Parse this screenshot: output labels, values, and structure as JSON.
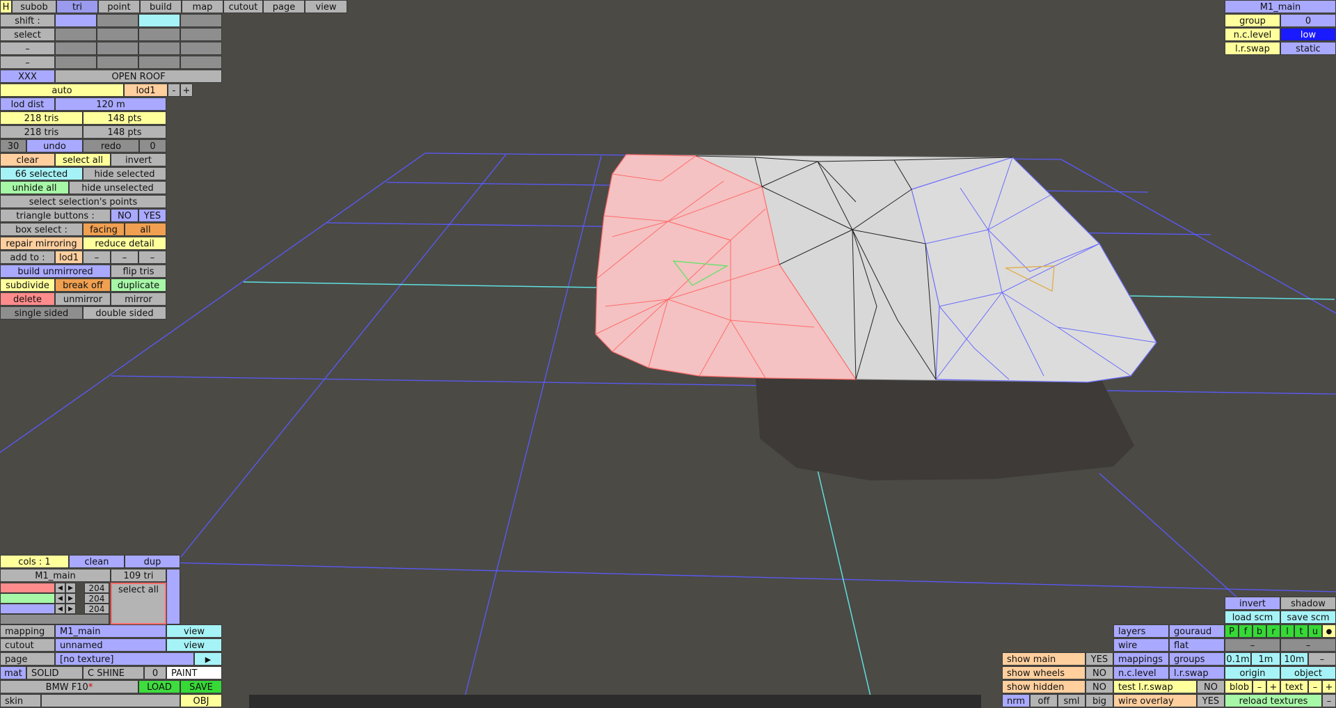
{
  "top_tabs": [
    "H",
    "subob",
    "tri",
    "point",
    "build",
    "map",
    "cutout",
    "page",
    "view"
  ],
  "shift_label": "shift :",
  "select_label": "select",
  "dash": "–",
  "xxx": "XXX",
  "open_roof": "OPEN ROOF",
  "auto": "auto",
  "lod1": "lod1",
  "minus": "-",
  "plus": "+",
  "lod_dist_label": "lod dist",
  "lod_dist_value": "120 m",
  "tris1": "218 tris",
  "pts1": "148 pts",
  "tris2": "218 tris",
  "pts2": "148 pts",
  "undo_count": "30",
  "undo": "undo",
  "redo": "redo",
  "redo_count": "0",
  "clear": "clear",
  "select_all": "select all",
  "invert": "invert",
  "selected_count": "66 selected",
  "hide_selected": "hide selected",
  "unhide_all": "unhide all",
  "hide_unselected": "hide unselected",
  "select_selection_points": "select selection's points",
  "triangle_buttons": "triangle buttons :",
  "no": "NO",
  "yes": "YES",
  "box_select": "box select :",
  "facing": "facing",
  "all": "all",
  "repair_mirroring": "repair mirroring",
  "reduce_detail": "reduce detail",
  "add_to": "add to :",
  "add_lod": "lod1",
  "build_unmirrored": "build unmirrored",
  "flip_tris": "flip tris",
  "subdivide": "subdivide",
  "break_off": "break off",
  "duplicate": "duplicate",
  "delete": "delete",
  "unmirror": "unmirror",
  "mirror": "mirror",
  "single_sided": "single sided",
  "double_sided": "double sided",
  "top_right": {
    "title": "M1_main",
    "group_label": "group",
    "group_value": "0",
    "nc_level_label": "n.c.level",
    "nc_level_value": "low",
    "lr_swap_label": "l.r.swap",
    "lr_swap_value": "static"
  },
  "bottom_left": {
    "cols": "cols : 1",
    "clean": "clean",
    "dup": "dup",
    "mat_name": "M1_main",
    "tri_count": "109 tri",
    "rgb": [
      "204",
      "204",
      "204"
    ],
    "select_all": "select all",
    "mapping_label": "mapping",
    "mapping_value": "M1_main",
    "view": "view",
    "cutout_label": "cutout",
    "cutout_value": "unnamed",
    "page_label": "page",
    "page_value": "[no texture]",
    "page_arrow": "▶",
    "mat": "mat",
    "solid": "SOLID",
    "c_shine": "C SHINE",
    "zero": "0",
    "paint": "PAINT",
    "car_name": "BMW F10",
    "asterisk": "*",
    "load": "LOAD",
    "save": "SAVE",
    "skin": "skin",
    "obj": "OBJ"
  },
  "bottom_right": {
    "invert": "invert",
    "shadow": "shadow",
    "load_scm": "load scm",
    "save_scm": "save scm",
    "layers": "layers",
    "gouraud": "gouraud",
    "letters": [
      "P",
      "f",
      "b",
      "r",
      "l",
      "t",
      "u"
    ],
    "dot": "●",
    "wire": "wire",
    "flat": "flat",
    "show_main": "show main",
    "show_main_v": "YES",
    "mappings": "mappings",
    "groups": "groups",
    "d01": "0.1m",
    "d1": "1m",
    "d10": "10m",
    "show_wheels": "show wheels",
    "show_wheels_v": "NO",
    "nc_level": "n.c.level",
    "lr_swap": "l.r.swap",
    "origin": "origin",
    "object": "object",
    "show_hidden": "show hidden",
    "show_hidden_v": "NO",
    "test_lr_swap": "test l.r.swap",
    "test_lr_swap_v": "NO",
    "blob": "blob",
    "text": "text",
    "nrm": "nrm",
    "off": "off",
    "sml": "sml",
    "big": "big",
    "wire_overlay": "wire overlay",
    "wire_overlay_v": "YES",
    "reload_textures": "reload textures"
  },
  "colors": {
    "background": "#4b4a45",
    "grid": "#5a5aff",
    "axis": "#5fe0e0",
    "mesh_fill": "#d8d8d8",
    "selected_red": "#ff6b6b",
    "selected_blue": "#6b6bff"
  }
}
